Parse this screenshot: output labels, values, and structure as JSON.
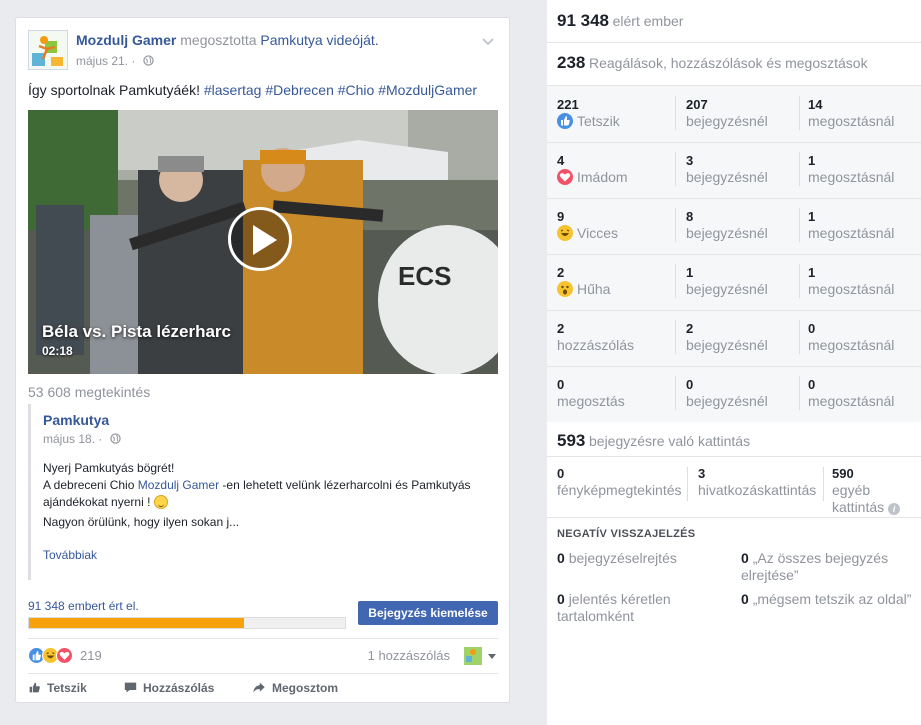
{
  "post": {
    "page_name": "Mozdulj Gamer",
    "shared_text": "megosztotta",
    "shared_from": "Pamkutya videóját.",
    "date": "május 21.",
    "text_plain": "Így sportolnak Pamkutyáék!",
    "hashtags": [
      "#lasertag",
      "#Debrecen",
      "#Chio",
      "#MozduljGamer"
    ],
    "video": {
      "title": "Béla vs. Pista lézerharc",
      "duration": "02:18"
    },
    "views": "53 608 megtekintés",
    "original": {
      "author": "Pamkutya",
      "date": "május 18.",
      "line1": "Nyerj Pamkutyás bögrét!",
      "line2_pre": "A debreceni Chio ",
      "line2_mention": "Mozdulj Gamer",
      "line2_post": " -en lehetett velünk lézerharcolni és Pamkutyás ajándékokat nyerni ! ",
      "line3": "Nagyon örülünk, hogy ilyen sokan j...",
      "more": "Továbbiak"
    },
    "reach_text": "91 348 embert ért el.",
    "reach_fraction": 0.68,
    "boost_label": "Bejegyzés kiemelése",
    "reaction_count": "219",
    "comments_count": "1 hozzászólás",
    "actions": {
      "like": "Tetszik",
      "comment": "Hozzászólás",
      "share": "Megosztom"
    }
  },
  "insights": {
    "reach": {
      "num": "91 348",
      "label": "elért ember"
    },
    "engagement": {
      "num": "238",
      "label": "Reagálások, hozzászólások és megosztások"
    },
    "rows": [
      {
        "total": "221",
        "label": "Tetszik",
        "icon": "like-icon",
        "post": "207",
        "post_label": "bejegyzésnél",
        "share": "14",
        "share_label": "megosztásnál"
      },
      {
        "total": "4",
        "label": "Imádom",
        "icon": "love-icon",
        "post": "3",
        "post_label": "bejegyzésnél",
        "share": "1",
        "share_label": "megosztásnál"
      },
      {
        "total": "9",
        "label": "Vicces",
        "icon": "haha-icon",
        "post": "8",
        "post_label": "bejegyzésnél",
        "share": "1",
        "share_label": "megosztásnál"
      },
      {
        "total": "2",
        "label": "Hűha",
        "icon": "wow-icon",
        "post": "1",
        "post_label": "bejegyzésnél",
        "share": "1",
        "share_label": "megosztásnál"
      },
      {
        "total": "2",
        "label": "hozzászólás",
        "icon": "",
        "post": "2",
        "post_label": "bejegyzésnél",
        "share": "0",
        "share_label": "megosztásnál"
      },
      {
        "total": "0",
        "label": "megosztás",
        "icon": "",
        "post": "0",
        "post_label": "bejegyzésnél",
        "share": "0",
        "share_label": "megosztásnál"
      }
    ],
    "clicks": {
      "num": "593",
      "label": "bejegyzésre való kattintás"
    },
    "click_breakdown": [
      {
        "value": "0",
        "label": "fényképmegtekintés"
      },
      {
        "value": "3",
        "label": "hivatkozáskattintás"
      },
      {
        "value": "590",
        "label": "egyéb kattintás"
      }
    ],
    "negative": {
      "title": "NEGATÍV VISSZAJELZÉS",
      "items": [
        {
          "value": "0",
          "label": "bejegyzéselrejtés"
        },
        {
          "value": "0",
          "label": "„Az összes bejegyzés elrejtése”"
        },
        {
          "value": "0",
          "label": "jelentés kéretlen tartalomként"
        },
        {
          "value": "0",
          "label": "„mégsem tetszik az oldal”"
        }
      ]
    }
  },
  "colors": {
    "link": "#365899",
    "boost_button": "#4267b2",
    "reach_bar": "#f7a10c",
    "muted_text": "#90949c"
  }
}
